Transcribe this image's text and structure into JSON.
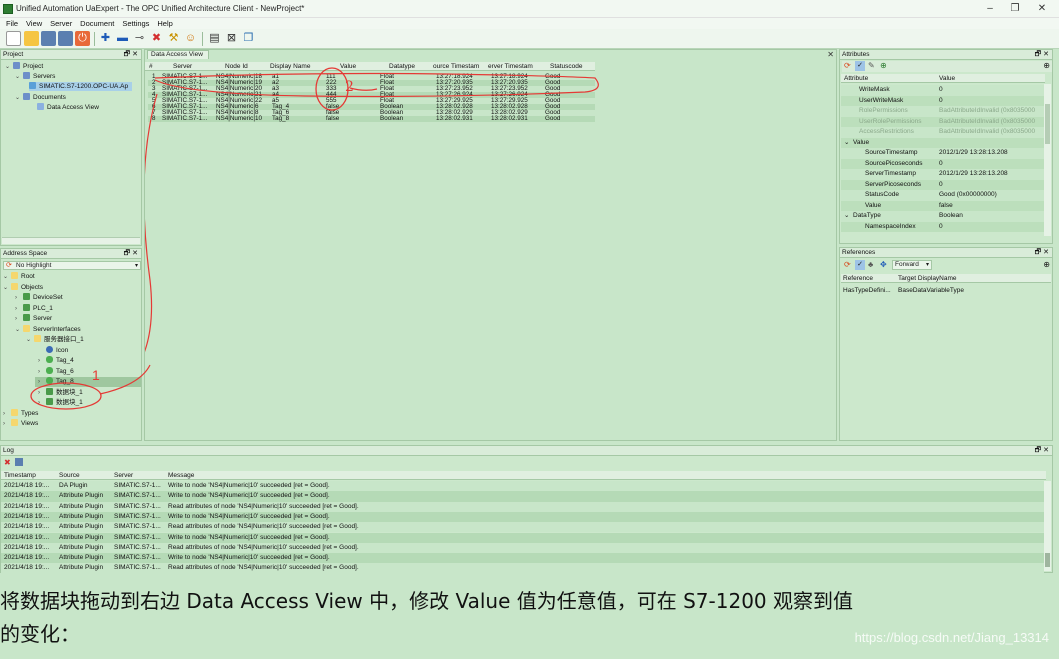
{
  "window": {
    "title": "Unified Automation UaExpert - The OPC Unified Architecture Client - NewProject*",
    "minimize": "–",
    "maximize": "❐",
    "close": "✕"
  },
  "menu": [
    "File",
    "View",
    "Server",
    "Document",
    "Settings",
    "Help"
  ],
  "project_panel": {
    "title": "Project",
    "buttons": "🗗 ✕",
    "items": [
      {
        "label": "Project",
        "icon": "project-icon",
        "expander": "⌄"
      },
      {
        "label": "Servers",
        "icon": "servers-folder-icon",
        "expander": "⌄"
      },
      {
        "label": "SIMATIC.S7-1200.OPC-UA.Ap",
        "icon": "server-icon",
        "expander": ""
      },
      {
        "label": "Documents",
        "icon": "documents-folder-icon",
        "expander": "⌄"
      },
      {
        "label": "Data Access View",
        "icon": "document-icon",
        "expander": ""
      }
    ]
  },
  "address_panel": {
    "title": "Address Space",
    "buttons": "🗗 ✕",
    "highlight_value": "No Highlight",
    "items": [
      {
        "label": "Root",
        "expander": "⌄",
        "icon": "folder-icon"
      },
      {
        "label": "Objects",
        "expander": "⌄",
        "icon": "folder-icon"
      },
      {
        "label": "DeviceSet",
        "expander": "›",
        "icon": "object-icon"
      },
      {
        "label": "PLC_1",
        "expander": "›",
        "icon": "object-icon"
      },
      {
        "label": "Server",
        "expander": "›",
        "icon": "object-icon"
      },
      {
        "label": "ServerInterfaces",
        "expander": "⌄",
        "icon": "folder-icon"
      },
      {
        "label": "服务器接口_1",
        "expander": "⌄",
        "icon": "folder-icon"
      },
      {
        "label": "Icon",
        "expander": "",
        "icon": "property-icon"
      },
      {
        "label": "Tag_4",
        "expander": "›",
        "icon": "variable-icon"
      },
      {
        "label": "Tag_6",
        "expander": "›",
        "icon": "variable-icon"
      },
      {
        "label": "Tag_8",
        "expander": "›",
        "icon": "variable-icon"
      },
      {
        "label": "数据块_1",
        "expander": "›",
        "icon": "object-icon"
      },
      {
        "label": "数据块_1",
        "expander": "›",
        "icon": "object-icon"
      },
      {
        "label": "Types",
        "expander": "›",
        "icon": "folder-icon"
      },
      {
        "label": "Views",
        "expander": "›",
        "icon": "folder-icon"
      }
    ]
  },
  "dav": {
    "tab": "Data Access View",
    "close": "✕",
    "columns": [
      "#",
      "Server",
      "Node Id",
      "Display Name",
      "Value",
      "Datatype",
      "ource Timestam",
      "erver Timestam",
      "Statuscode"
    ],
    "rows": [
      [
        "1",
        "SIMATIC.S7-1...",
        "NS4|Numeric|18",
        "a1",
        "111",
        "Float",
        "13:27:18.924",
        "13:27:18.924",
        "Good"
      ],
      [
        "2",
        "SIMATIC.S7-1...",
        "NS4|Numeric|19",
        "a2",
        "222",
        "Float",
        "13:27:20.935",
        "13:27:20.935",
        "Good"
      ],
      [
        "3",
        "SIMATIC.S7-1...",
        "NS4|Numeric|20",
        "a3",
        "333",
        "Float",
        "13:27:23.952",
        "13:27:23.952",
        "Good"
      ],
      [
        "4",
        "SIMATIC.S7-1...",
        "NS4|Numeric|21",
        "a4",
        "444",
        "Float",
        "13:27:26.924",
        "13:27:26.924",
        "Good"
      ],
      [
        "5",
        "SIMATIC.S7-1...",
        "NS4|Numeric|22",
        "a5",
        "555",
        "Float",
        "13:27:29.925",
        "13:27:29.925",
        "Good"
      ],
      [
        "6",
        "SIMATIC.S7-1...",
        "NS4|Numeric|6",
        "Tag_4",
        "false",
        "Boolean",
        "13:28:02.928",
        "13:28:02.928",
        "Good"
      ],
      [
        "7",
        "SIMATIC.S7-1...",
        "NS4|Numeric|8",
        "Tag_6",
        "false",
        "Boolean",
        "13:28:02.929",
        "13:28:02.929",
        "Good"
      ],
      [
        "8",
        "SIMATIC.S7-1...",
        "NS4|Numeric|10",
        "Tag_8",
        "false",
        "Boolean",
        "13:28:02.931",
        "13:28:02.931",
        "Good"
      ]
    ],
    "annotation_1": "1",
    "annotation_2": "2"
  },
  "attributes": {
    "title": "Attributes",
    "buttons": "🗗 ✕",
    "columns": [
      "Attribute",
      "Value"
    ],
    "rows": [
      {
        "name": "WriteMask",
        "value": "0",
        "indent": 1,
        "dim": false,
        "exp": ""
      },
      {
        "name": "UserWriteMask",
        "value": "0",
        "indent": 1,
        "dim": false,
        "exp": ""
      },
      {
        "name": "RolePermissions",
        "value": "BadAttributeIdInvalid (0x8035000",
        "indent": 1,
        "dim": true,
        "exp": ""
      },
      {
        "name": "UserRolePermissions",
        "value": "BadAttributeIdInvalid (0x8035000",
        "indent": 1,
        "dim": true,
        "exp": ""
      },
      {
        "name": "AccessRestrictions",
        "value": "BadAttributeIdInvalid (0x8035000",
        "indent": 1,
        "dim": true,
        "exp": ""
      },
      {
        "name": "Value",
        "value": "",
        "indent": 0,
        "dim": false,
        "exp": "⌄"
      },
      {
        "name": "SourceTimestamp",
        "value": "2012/1/29 13:28:13.208",
        "indent": 2,
        "dim": false,
        "exp": ""
      },
      {
        "name": "SourcePicoseconds",
        "value": "0",
        "indent": 2,
        "dim": false,
        "exp": ""
      },
      {
        "name": "ServerTimestamp",
        "value": "2012/1/29 13:28:13.208",
        "indent": 2,
        "dim": false,
        "exp": ""
      },
      {
        "name": "ServerPicoseconds",
        "value": "0",
        "indent": 2,
        "dim": false,
        "exp": ""
      },
      {
        "name": "StatusCode",
        "value": "Good (0x00000000)",
        "indent": 2,
        "dim": false,
        "exp": ""
      },
      {
        "name": "Value",
        "value": "false",
        "indent": 2,
        "dim": false,
        "exp": ""
      },
      {
        "name": "DataType",
        "value": "Boolean",
        "indent": 0,
        "dim": false,
        "exp": "⌄"
      },
      {
        "name": "NamespaceIndex",
        "value": "0",
        "indent": 2,
        "dim": false,
        "exp": ""
      }
    ]
  },
  "references": {
    "title": "References",
    "buttons": "🗗 ✕",
    "direction": "Forward",
    "columns": [
      "Reference",
      "Target DisplayName"
    ],
    "rows": [
      [
        "HasTypeDefini...",
        "BaseDataVariableType"
      ]
    ]
  },
  "log": {
    "title": "Log",
    "buttons": "🗗 ✕",
    "columns": [
      "Timestamp",
      "Source",
      "Server",
      "Message"
    ],
    "rows": [
      [
        "2021/4/18 19:...",
        "DA Plugin",
        "SIMATIC.S7-1...",
        "Write to node 'NS4|Numeric|10' succeeded [ret = Good]."
      ],
      [
        "2021/4/18 19:...",
        "Attribute Plugin",
        "SIMATIC.S7-1...",
        "Write to node 'NS4|Numeric|10' succeeded [ret = Good]."
      ],
      [
        "2021/4/18 19:...",
        "Attribute Plugin",
        "SIMATIC.S7-1...",
        "Read attributes of node 'NS4|Numeric|10' succeeded [ret = Good]."
      ],
      [
        "2021/4/18 19:...",
        "Attribute Plugin",
        "SIMATIC.S7-1...",
        "Write to node 'NS4|Numeric|10' succeeded [ret = Good]."
      ],
      [
        "2021/4/18 19:...",
        "Attribute Plugin",
        "SIMATIC.S7-1...",
        "Read attributes of node 'NS4|Numeric|10' succeeded [ret = Good]."
      ],
      [
        "2021/4/18 19:...",
        "Attribute Plugin",
        "SIMATIC.S7-1...",
        "Write to node 'NS4|Numeric|10' succeeded [ret = Good]."
      ],
      [
        "2021/4/18 19:...",
        "Attribute Plugin",
        "SIMATIC.S7-1...",
        "Read attributes of node 'NS4|Numeric|10' succeeded [ret = Good]."
      ],
      [
        "2021/4/18 19:...",
        "Attribute Plugin",
        "SIMATIC.S7-1...",
        "Write to node 'NS4|Numeric|10' succeeded [ret = Good]."
      ],
      [
        "2021/4/18 19:...",
        "Attribute Plugin",
        "SIMATIC.S7-1...",
        "Read attributes of node 'NS4|Numeric|10' succeeded [ret = Good]."
      ]
    ]
  },
  "caption": {
    "line1": "将数据块拖动到右边 Data Access View 中，修改 Value 值为任意值，可在 S7-1200 观察到值",
    "line2": "的变化："
  },
  "watermark": "https://blog.csdn.net/Jiang_13314",
  "colors": {
    "background": "#c8e6c9",
    "row_alt": "#b5dab6",
    "annotation_red": "#e53935",
    "selection": "#a8d0a8"
  }
}
